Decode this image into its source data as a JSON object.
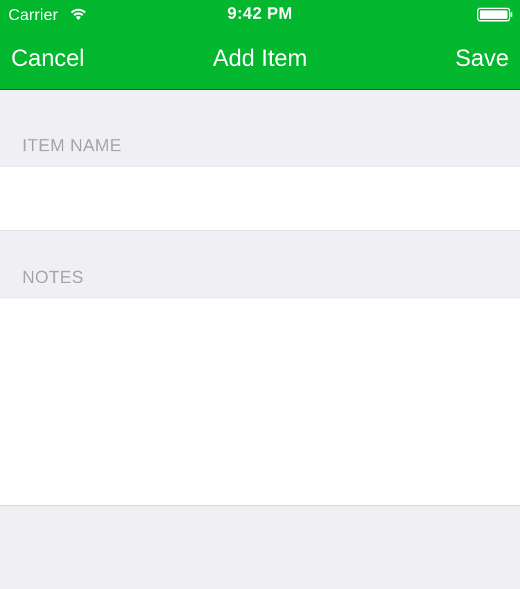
{
  "status_bar": {
    "carrier": "Carrier",
    "time": "9:42 PM",
    "wifi_icon": "wifi-icon",
    "battery_icon": "battery-full-icon"
  },
  "nav_bar": {
    "cancel_label": "Cancel",
    "title": "Add Item",
    "save_label": "Save",
    "background_color": "#03b72f"
  },
  "form": {
    "item_name": {
      "label": "ITEM NAME",
      "value": ""
    },
    "notes": {
      "label": "NOTES",
      "value": ""
    }
  },
  "colors": {
    "accent": "#03b72f",
    "page_background": "#efeff4",
    "section_label": "#a5a5aa"
  }
}
